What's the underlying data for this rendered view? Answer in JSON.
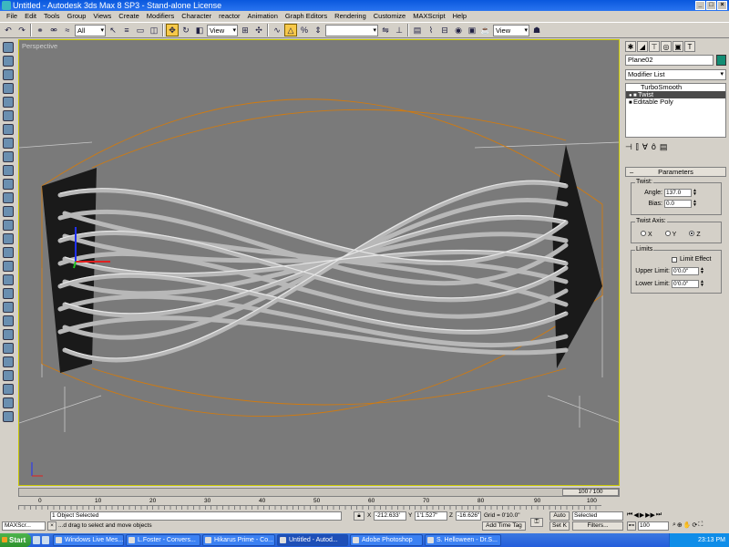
{
  "window": {
    "title": "Untitled - Autodesk 3ds Max 8 SP3 - Stand-alone License"
  },
  "menu": [
    "File",
    "Edit",
    "Tools",
    "Group",
    "Views",
    "Create",
    "Modifiers",
    "Character",
    "reactor",
    "Animation",
    "Graph Editors",
    "Rendering",
    "Customize",
    "MAXScript",
    "Help"
  ],
  "toolbar": {
    "selection_filter": "All",
    "ref_coord": "View",
    "named_selection": "",
    "ref_coord_2": "View"
  },
  "viewport": {
    "label": "Perspective"
  },
  "command_panel": {
    "object_name": "Plane02",
    "object_color": "#138d74",
    "modifier_list": "Modifier List",
    "stack": [
      "TurboSmooth",
      "Twist",
      "Editable Poly"
    ],
    "selected_stack_item": "Twist",
    "rollout_title": "Parameters",
    "twist": {
      "group_label": "Twist:",
      "angle_label": "Angle:",
      "angle_value": "137.0",
      "bias_label": "Bias:",
      "bias_value": "0.0"
    },
    "twist_axis": {
      "group_label": "Twist Axis:",
      "options": [
        "X",
        "Y",
        "Z"
      ],
      "selected": "Z"
    },
    "limits": {
      "group_label": "Limits",
      "limit_effect_label": "Limit Effect",
      "upper_label": "Upper Limit:",
      "upper_value": "0'0.0\"",
      "lower_label": "Lower Limit:",
      "lower_value": "0'0.0\""
    }
  },
  "timeline": {
    "slider_text": "100 / 100",
    "ticks": [
      "0",
      "10",
      "20",
      "30",
      "40",
      "50",
      "60",
      "70",
      "80",
      "90",
      "100"
    ]
  },
  "status": {
    "selection_count": "1 Object Selected",
    "prompt": "...d drag to select and move objects",
    "mini_listener": "MAXScr...",
    "x_value": "-212.633'",
    "y_value": "1'1.527\"",
    "z_value": "-16.626\"",
    "grid_label": "Grid = 0'10.0\"",
    "auto_key": "Auto",
    "set_key": "Set K",
    "key_filter": "Selected",
    "filters": "Filters...",
    "add_time_tag": "Add Time Tag",
    "frame": "100"
  },
  "taskbar": {
    "start": "Start",
    "tasks": [
      "Windows Live Mes...",
      "L.Foster - Convers...",
      "Hikarus Prime - Co...",
      "Untitled - Autod...",
      "Adobe Photoshop",
      "S. Helloween - Dr.S..."
    ],
    "active_task": "Untitled - Autod...",
    "clock": "23:13 PM"
  }
}
